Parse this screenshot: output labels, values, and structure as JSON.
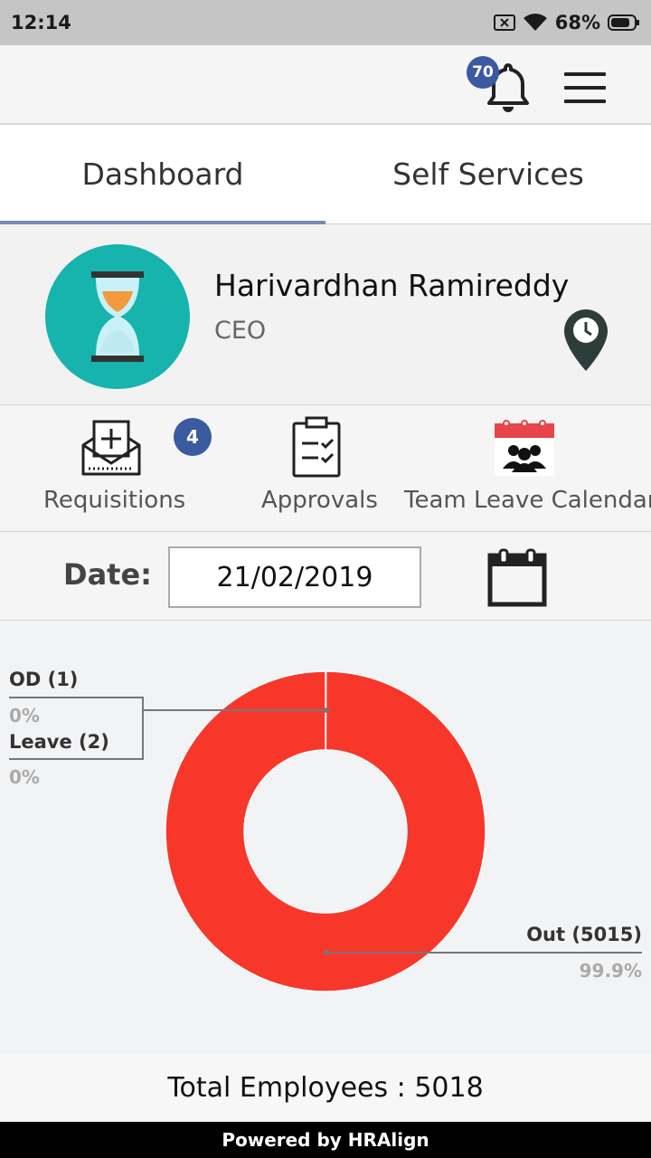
{
  "status_bar": {
    "time": "12:14",
    "battery": "68%"
  },
  "header": {
    "notification_count": "70"
  },
  "tabs": [
    {
      "label": "Dashboard",
      "active": true
    },
    {
      "label": "Self Services",
      "active": false
    }
  ],
  "profile": {
    "name": "Harivardhan Ramireddy",
    "role": "CEO"
  },
  "quick_actions": [
    {
      "label": "Requisitions",
      "badge": "4"
    },
    {
      "label": "Approvals"
    },
    {
      "label": "Team Leave Calendar"
    }
  ],
  "date_filter": {
    "label": "Date:",
    "value": "21/02/2019"
  },
  "chart_data": {
    "type": "pie",
    "donut": true,
    "slices": [
      {
        "label": "OD (1)",
        "name": "OD",
        "count": 1,
        "percent_label": "0%",
        "value": 1,
        "color": "#9e9e9e"
      },
      {
        "label": "Leave (2)",
        "name": "Leave",
        "count": 2,
        "percent_label": "0%",
        "value": 2,
        "color": "#9e9e9e"
      },
      {
        "label": "Out (5015)",
        "name": "Out",
        "count": 5015,
        "percent_label": "99.9%",
        "value": 5015,
        "color": "#f8372b"
      }
    ]
  },
  "summary": {
    "total_label": "Total Employees : 5018"
  },
  "footer": {
    "text": "Powered by HRAlign"
  }
}
